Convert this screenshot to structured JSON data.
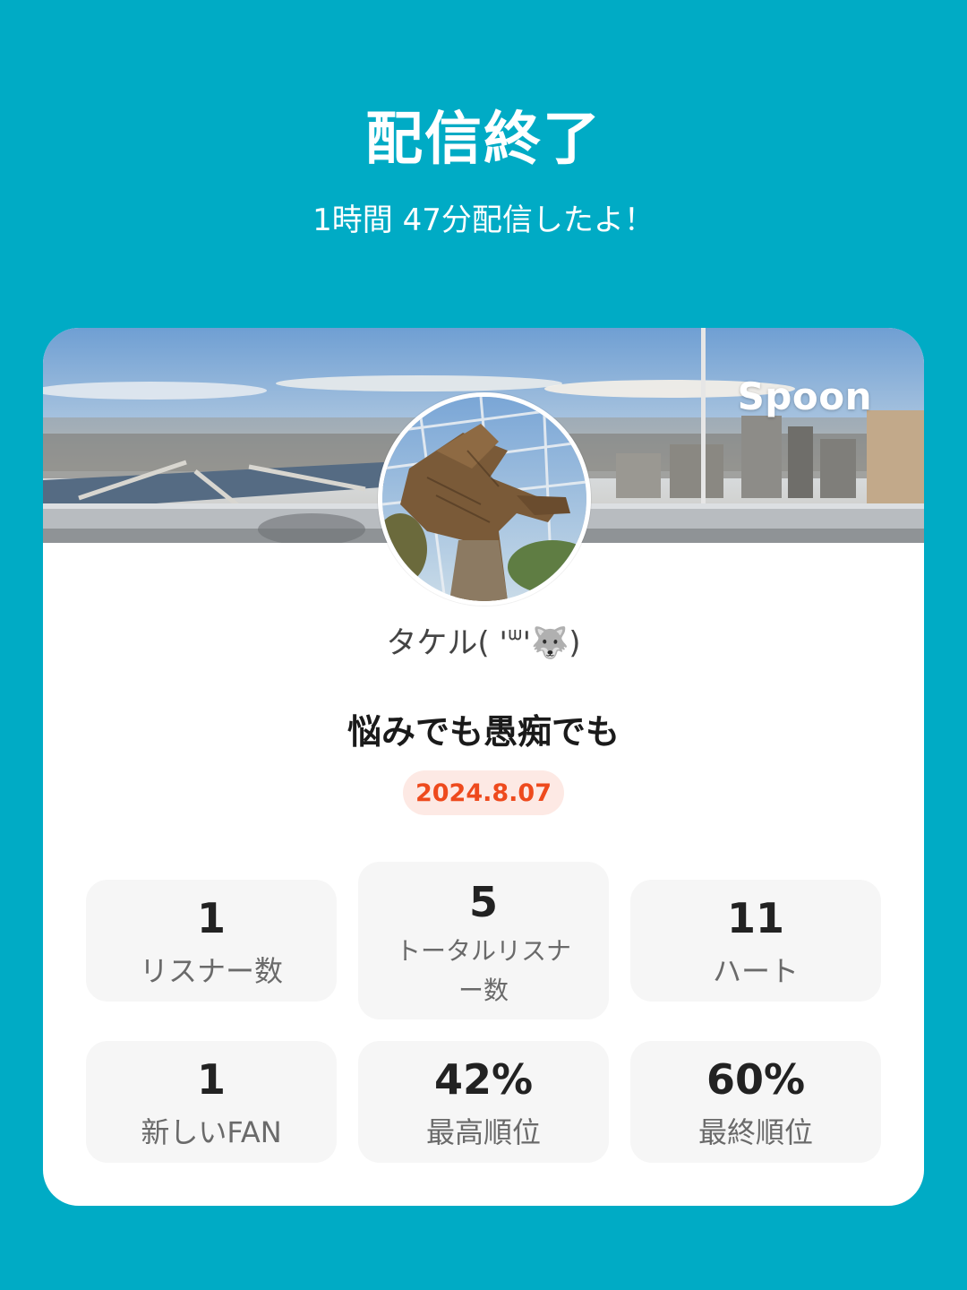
{
  "header": {
    "title": "配信終了",
    "subtitle": "1時間 47分配信したよ！"
  },
  "card": {
    "brand": "Spoon",
    "username": "タケル( 'ᐜ'🐺)",
    "live_title": "悩みでも愚痴でも",
    "date": "2024.8.07"
  },
  "stats": [
    {
      "value": "1",
      "label": "リスナー数"
    },
    {
      "value": "5",
      "label": "トータルリスナ\nー数"
    },
    {
      "value": "11",
      "label": "ハート"
    },
    {
      "value": "1",
      "label": "新しいFAN"
    },
    {
      "value": "42%",
      "label": "最高順位"
    },
    {
      "value": "60%",
      "label": "最終順位"
    }
  ],
  "colors": {
    "background": "#00abc5",
    "date_badge_bg": "#fde9e4",
    "date_badge_text": "#ee4a1d",
    "stat_tile_bg": "#f6f6f6"
  }
}
